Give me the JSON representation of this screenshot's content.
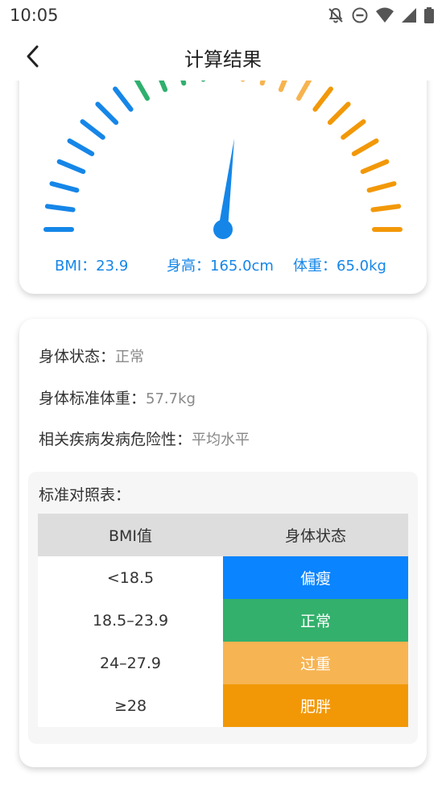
{
  "status_bar": {
    "time": "10:05"
  },
  "app_bar": {
    "title": "计算结果"
  },
  "gauge": {
    "bmi": "BMI：23.9",
    "height": "身高：165.0cm",
    "weight": "体重：65.0kg",
    "colors": {
      "underweight": "#1586e8",
      "normal": "#2fb06e",
      "overweight": "#f7b34f",
      "obese": "#f29808",
      "needle": "#1586e8"
    }
  },
  "info": {
    "status_label": "身体状态：",
    "status_value": "正常",
    "std_weight_label": "身体标准体重：",
    "std_weight_value": "57.7kg",
    "risk_label": "相关疾病发病危险性：",
    "risk_value": "平均水平"
  },
  "reference": {
    "title": "标准对照表：",
    "headers": [
      "BMI值",
      "身体状态"
    ],
    "rows": [
      {
        "bmi": "<18.5",
        "status": "偏瘦",
        "color": "#0a84ff"
      },
      {
        "bmi": "18.5–23.9",
        "status": "正常",
        "color": "#33b06b"
      },
      {
        "bmi": "24–27.9",
        "status": "过重",
        "color": "#f7b452"
      },
      {
        "bmi": "≥28",
        "status": "肥胖",
        "color": "#f29807"
      }
    ]
  }
}
